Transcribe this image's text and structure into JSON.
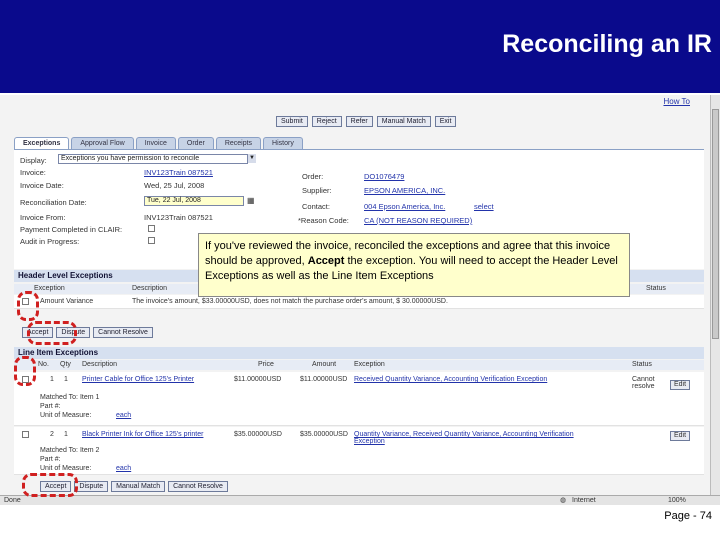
{
  "slide": {
    "title": "Reconciling an IR",
    "page": "Page - 74"
  },
  "app": {
    "how_to": "How To",
    "toolbar": [
      "Submit",
      "Reject",
      "Refer",
      "Manual Match",
      "Exit"
    ],
    "tabs": [
      "Exceptions",
      "Approval Flow",
      "Invoice",
      "Order",
      "Receipts",
      "History"
    ],
    "display_label": "Display:",
    "display_value": "Exceptions you have permission to reconcile",
    "fields_left": [
      {
        "label": "Invoice:",
        "value": "INV123Train 087521"
      },
      {
        "label": "Invoice Date:",
        "value": "Wed, 25 Jul, 2008"
      },
      {
        "label": "Reconciliation Date:",
        "value": "Tue, 22 Jul, 2008"
      },
      {
        "label": "Invoice From:",
        "value": "INV123Train 087521"
      },
      {
        "label": "Payment Completed in CLAIR:",
        "value": ""
      },
      {
        "label": "Audit in Progress:",
        "value": ""
      }
    ],
    "fields_right": [
      {
        "label": "Order:",
        "value": "DO1076479"
      },
      {
        "label": "Supplier:",
        "value": "EPSON AMERICA, INC."
      },
      {
        "label": "Contact:",
        "value": "004 Epson America, Inc.",
        "action": "select"
      },
      {
        "label": "*Reason Code:",
        "value": "CA (NOT REASON REQUIRED)"
      }
    ],
    "header_exceptions": {
      "title": "Header Level Exceptions",
      "columns": [
        "Exception",
        "Description",
        "Status"
      ],
      "row": {
        "exception": "Amount Variance",
        "description": "The invoice's amount, $33.00000USD, does not match the purchase order's amount, $ 30.00000USD."
      },
      "buttons": [
        "Accept",
        "Dispute",
        "Cannot Resolve"
      ]
    },
    "line_exceptions": {
      "title": "Line Item Exceptions",
      "columns": [
        "No.",
        "Qty",
        "Description",
        "Price",
        "Amount",
        "Exception",
        "Status"
      ],
      "rows": [
        {
          "no": "1",
          "qty": "1",
          "description": "Printer Cable for Office 125's Printer",
          "price": "$11.00000USD",
          "amount": "$11.00000USD",
          "exception": "Received Quantity Variance, Accounting Verification Exception",
          "status": "Cannot resolve",
          "matched": "Matched To: Item 1",
          "part": "Part #:",
          "uom_label": "Unit of Measure:",
          "uom": "each"
        },
        {
          "no": "2",
          "qty": "1",
          "description": "Black Printer Ink for Office 125's printer",
          "price": "$35.00000USD",
          "amount": "$35.00000USD",
          "exception": "Quantity Variance, Received Quantity Variance, Accounting Verification Exception",
          "status": "",
          "matched": "Matched To: Item 2",
          "part": "Part #:",
          "uom_label": "Unit of Measure:",
          "uom": "each"
        }
      ],
      "buttons": [
        "Accept",
        "Dispute",
        "Manual Match",
        "Cannot Resolve"
      ],
      "edit": "Edit"
    },
    "status": {
      "left": "Done",
      "zone": "Internet",
      "zoom": "100%"
    }
  },
  "callout": {
    "before": "If you've reviewed the invoice, reconciled the exceptions and agree that this invoice should be approved, ",
    "bold": "Accept",
    "after": " the exception.  You will need to accept the Header Level Exceptions as well as the Line Item Exceptions"
  },
  "colors": {
    "header": "#0a0a8c",
    "callout_bg": "#ffffcc",
    "highlight_dash": "#d02020"
  }
}
